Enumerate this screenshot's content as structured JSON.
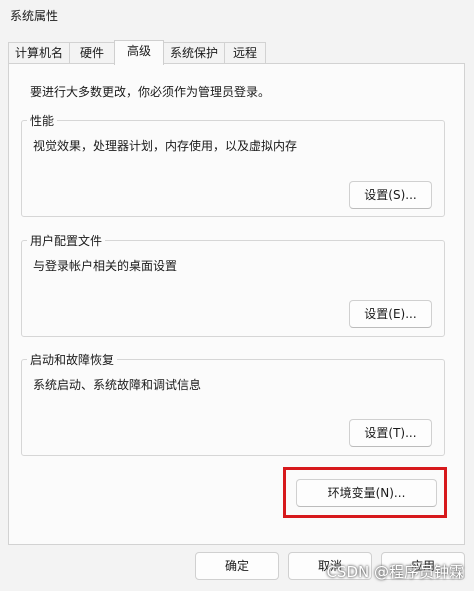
{
  "window": {
    "title": "系统属性"
  },
  "tabs": [
    {
      "label": "计算机名"
    },
    {
      "label": "硬件"
    },
    {
      "label": "高级",
      "active": true
    },
    {
      "label": "系统保护"
    },
    {
      "label": "远程"
    }
  ],
  "notice": "要进行大多数更改，你必须作为管理员登录。",
  "groups": {
    "performance": {
      "title": "性能",
      "desc": "视觉效果，处理器计划，内存使用，以及虚拟内存",
      "button": "设置(S)..."
    },
    "profiles": {
      "title": "用户配置文件",
      "desc": "与登录帐户相关的桌面设置",
      "button": "设置(E)..."
    },
    "startup": {
      "title": "启动和故障恢复",
      "desc": "系统启动、系统故障和调试信息",
      "button": "设置(T)..."
    }
  },
  "env_button": "环境变量(N)...",
  "footer": {
    "ok": "确定",
    "cancel": "取消",
    "apply": "应用"
  },
  "watermark": "CSDN @程序员钟霖",
  "colors": {
    "highlight": "#d7191c"
  }
}
